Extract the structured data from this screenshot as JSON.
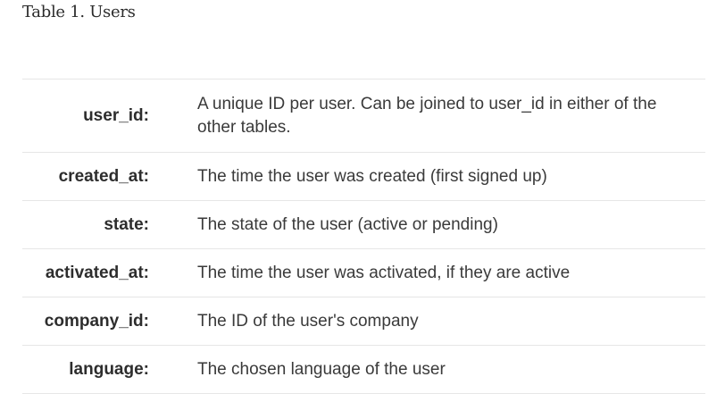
{
  "caption": "Table 1. Users",
  "rows": [
    {
      "field": "user_id:",
      "description": "A unique ID per user. Can be joined to user_id in either of the other tables."
    },
    {
      "field": "created_at:",
      "description": "The time the user was created (first signed up)"
    },
    {
      "field": "state:",
      "description": "The state of the user (active or pending)"
    },
    {
      "field": "activated_at:",
      "description": "The time the user was activated, if they are active"
    },
    {
      "field": "company_id:",
      "description": "The ID of the user's company"
    },
    {
      "field": "language:",
      "description": "The chosen language of the user"
    }
  ]
}
